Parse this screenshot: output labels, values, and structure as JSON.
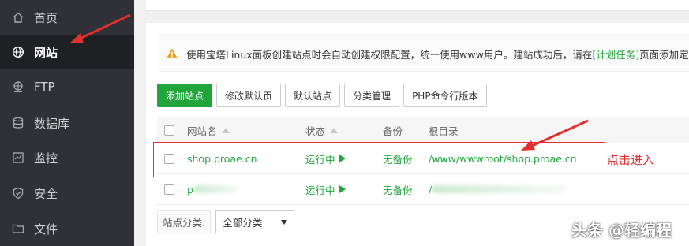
{
  "sidebar": {
    "items": [
      {
        "label": "首页",
        "icon": "home-icon"
      },
      {
        "label": "网站",
        "icon": "globe-icon",
        "active": true
      },
      {
        "label": "FTP",
        "icon": "ftp-icon"
      },
      {
        "label": "数据库",
        "icon": "database-icon"
      },
      {
        "label": "监控",
        "icon": "monitor-icon"
      },
      {
        "label": "安全",
        "icon": "shield-icon"
      },
      {
        "label": "文件",
        "icon": "folder-icon"
      }
    ]
  },
  "notice": {
    "text_before": "使用宝塔Linux面板创建站点时会自动创建权限配置，统一使用www用户。建站成功后，请在",
    "link": "[计划任务]",
    "text_after": "页面添加定时备份"
  },
  "toolbar": {
    "add_site": "添加站点",
    "modify_default_page": "修改默认页",
    "default_site": "默认站点",
    "category_manage": "分类管理",
    "php_cli_version": "PHP命令行版本"
  },
  "table": {
    "columns": [
      "网站名",
      "状态",
      "备份",
      "根目录"
    ],
    "rows": [
      {
        "name": "shop.proae.cn",
        "status": "运行中",
        "backup": "无备份",
        "root": "/www/wwwroot/shop.proae.cn"
      },
      {
        "name": "p",
        "status": "运行中",
        "backup": "无备份",
        "root": "/"
      }
    ]
  },
  "filter": {
    "label": "站点分类:",
    "selected": "全部分类"
  },
  "annotation": {
    "note": "点击进入"
  },
  "watermark": "头条 @轻编程",
  "colors": {
    "accent_green": "#20a53a",
    "annotation_red": "#e03030",
    "sidebar_bg": "#2f3136"
  }
}
